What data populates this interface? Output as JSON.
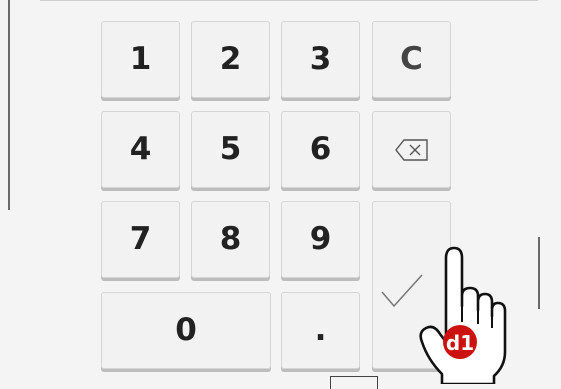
{
  "keypad": {
    "keys": {
      "one": "1",
      "two": "2",
      "three": "3",
      "clear": "C",
      "four": "4",
      "five": "5",
      "six": "6",
      "seven": "7",
      "eight": "8",
      "nine": "9",
      "zero": "0",
      "dot": "."
    },
    "backspace_icon": "backspace-icon",
    "confirm_icon": "checkmark-icon"
  },
  "gesture": {
    "icon": "tap-hand-icon",
    "badge_label": "d1",
    "badge_color": "#cc1111"
  }
}
